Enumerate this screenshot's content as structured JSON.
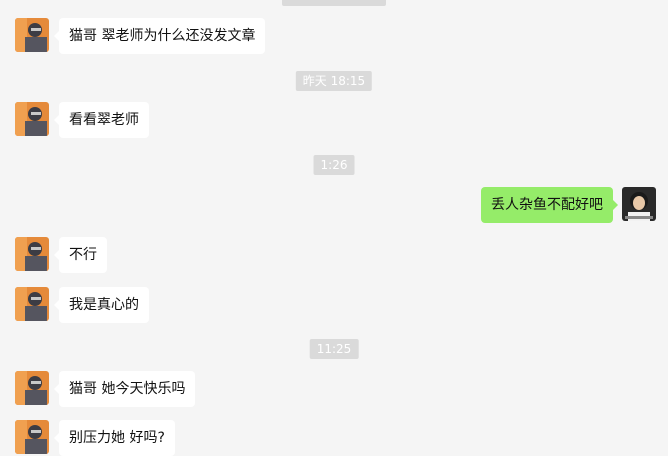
{
  "chat": {
    "timestamps": {
      "t1": "昨天 18:15",
      "t2": "1:26",
      "t3": "11:25"
    },
    "messages": [
      {
        "sender": "other",
        "text": "猫哥 翠老师为什么还没发文章"
      },
      {
        "sender": "other",
        "text": "看看翠老师"
      },
      {
        "sender": "self",
        "text": "丢人杂鱼不配好吧"
      },
      {
        "sender": "other",
        "text": "不行"
      },
      {
        "sender": "other",
        "text": "我是真心的"
      },
      {
        "sender": "other",
        "text": "猫哥 她今天快乐吗"
      },
      {
        "sender": "other",
        "text": "别压力她 好吗?"
      }
    ]
  },
  "colors": {
    "background": "#f5f5f5",
    "bubble_other": "#ffffff",
    "bubble_self": "#95ec69",
    "timestamp_bg": "#dadada",
    "timestamp_text": "#ffffff"
  }
}
